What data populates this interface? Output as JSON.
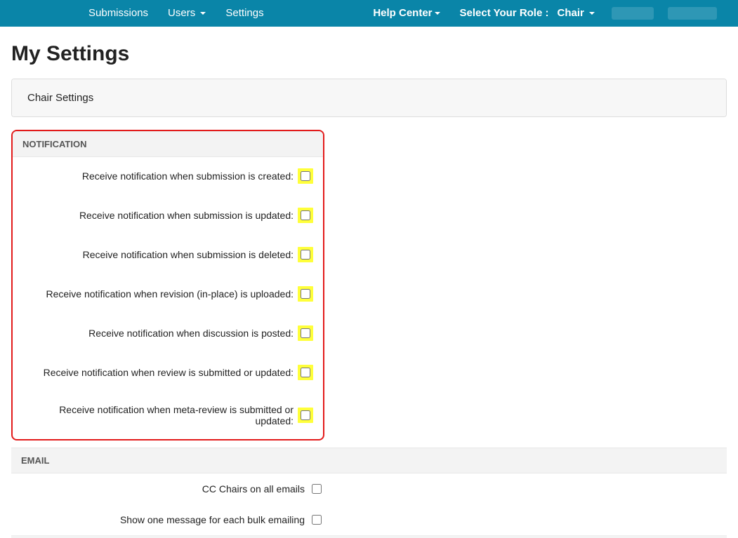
{
  "nav": {
    "left": {
      "submissions": "Submissions",
      "users": "Users",
      "settings": "Settings"
    },
    "right": {
      "help": "Help Center",
      "role_label": "Select Your Role :",
      "role_value": "Chair"
    }
  },
  "page": {
    "title": "My Settings",
    "panel_title": "Chair Settings"
  },
  "sections": {
    "notification": {
      "title": "NOTIFICATION",
      "items": [
        "Receive notification when submission is created:",
        "Receive notification when submission is updated:",
        "Receive notification when submission is deleted:",
        "Receive notification when revision (in-place) is uploaded:",
        "Receive notification when discussion is posted:",
        "Receive notification when review is submitted or updated:",
        "Receive notification when meta-review is submitted or updated:"
      ]
    },
    "email": {
      "title": "EMAIL",
      "items": [
        "CC Chairs on all emails",
        "Show one message for each bulk emailing"
      ]
    }
  }
}
